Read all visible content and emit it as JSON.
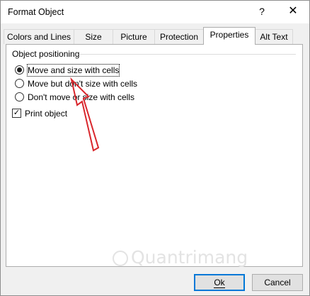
{
  "window": {
    "title": "Format Object",
    "help_glyph": "?",
    "close_glyph": "✕"
  },
  "tabs": [
    {
      "label": "Colors and Lines"
    },
    {
      "label": "Size"
    },
    {
      "label": "Picture"
    },
    {
      "label": "Protection"
    },
    {
      "label": "Properties",
      "active": true
    },
    {
      "label": "Alt Text"
    }
  ],
  "group": {
    "label": "Object positioning"
  },
  "options": [
    {
      "label": "Move and size with cells",
      "checked": true
    },
    {
      "label": "Move but don't size with cells",
      "checked": false
    },
    {
      "label": "Don't move or size with cells",
      "checked": false
    }
  ],
  "print_object": {
    "label": "Print object",
    "checked": true,
    "mark": "✓"
  },
  "watermark": {
    "text": "Quantrimang"
  },
  "buttons": {
    "ok": "Ok",
    "cancel": "Cancel"
  },
  "annotation": {
    "arrow_color": "#d9262c"
  }
}
